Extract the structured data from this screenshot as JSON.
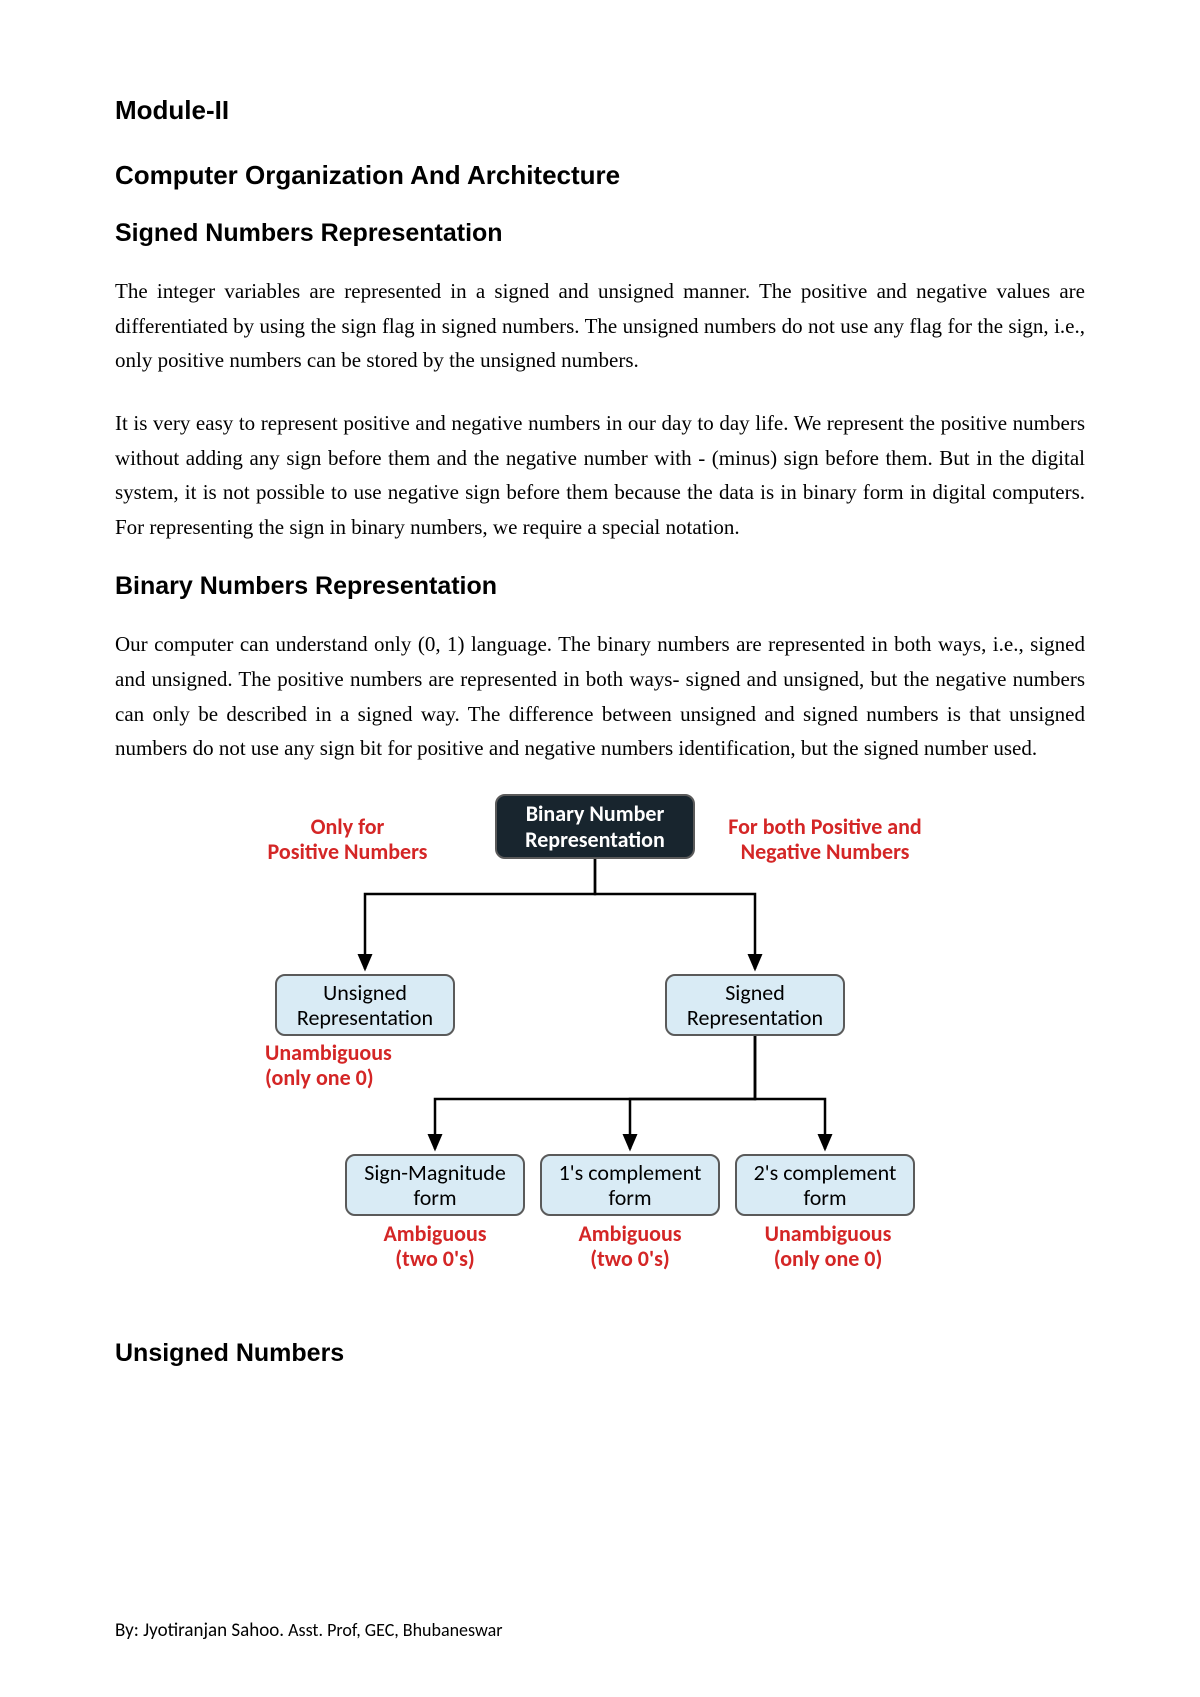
{
  "headings": {
    "module": "Module-II",
    "course": "Computer Organization And Architecture",
    "topic": "Signed Numbers Representation",
    "section_binary": "Binary Numbers Representation",
    "section_unsigned": "Unsigned Numbers"
  },
  "paragraphs": {
    "p1": "The integer variables are represented in a signed and unsigned manner. The positive and negative values are differentiated by using the sign flag in signed numbers. The unsigned numbers do not use any flag for the sign, i.e., only positive numbers can be stored by the unsigned numbers.",
    "p2": "It is very easy to represent positive and negative numbers in our day to day life. We represent the positive numbers without adding any sign before them and the negative number with - (minus) sign before them. But in the digital system, it is not possible to use negative sign before them because the data is in binary form in digital computers. For representing the sign in binary numbers, we require a special notation.",
    "p3": "Our computer can understand only (0, 1) language. The binary numbers are represented in both ways, i.e., signed and unsigned. The positive numbers are represented in both ways- signed and unsigned, but the negative numbers can only be described in a signed way. The difference between unsigned and signed numbers is that unsigned numbers do not use any sign bit for positive and negative numbers identification, but the signed number used."
  },
  "diagram": {
    "root": "Binary Number\nRepresentation",
    "left_label": "Only for\nPositive Numbers",
    "right_label": "For both Positive and\nNegative Numbers",
    "unsigned": "Unsigned\nRepresentation",
    "signed": "Signed\nRepresentation",
    "unsigned_note": "Unambiguous\n(only one 0)",
    "leaf1": "Sign-Magnitude\nform",
    "leaf2": "1's complement\nform",
    "leaf3": "2's complement\nform",
    "leaf1_note": "Ambiguous\n(two 0's)",
    "leaf2_note": "Ambiguous\n(two 0's)",
    "leaf3_note": "Unambiguous\n(only one 0)"
  },
  "footer": {
    "author": "By: Jyotiranjan Sahoo.",
    "role": "Asst. Prof, GEC, Bhubaneswar"
  }
}
